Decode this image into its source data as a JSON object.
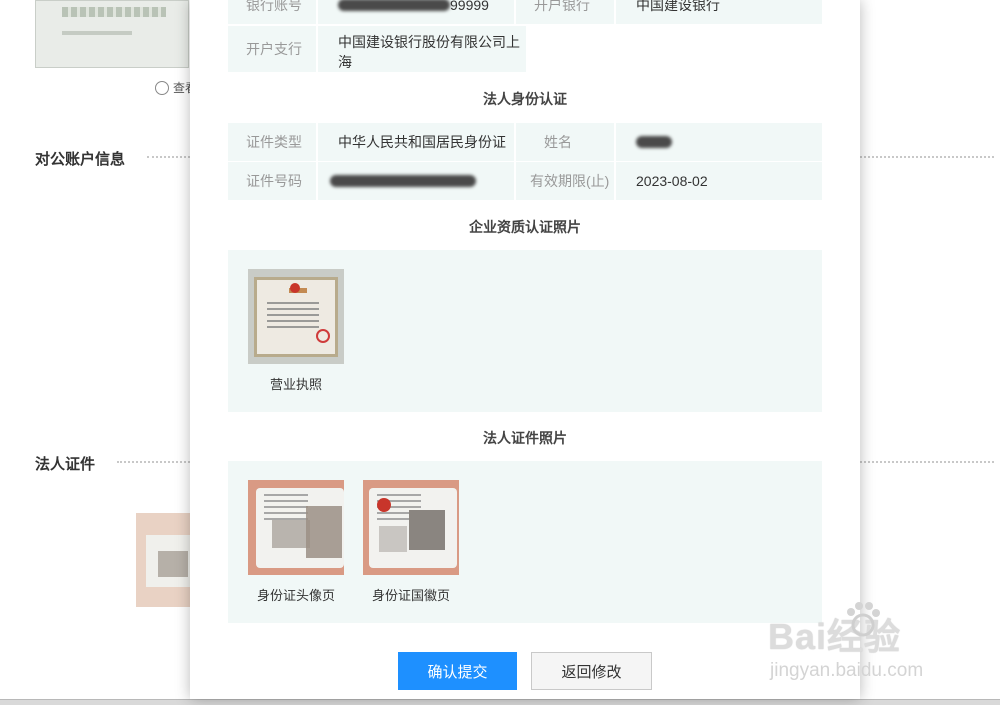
{
  "background": {
    "view_link": "查看",
    "headings": {
      "account_info": "对公账户信息",
      "legal_cert": "法人证件"
    }
  },
  "account_rows": [
    {
      "label1": "银行账号",
      "value1_visible": "99999",
      "label2": "开户银行",
      "value2": "中国建设银行"
    },
    {
      "label1": "开户支行",
      "value1": "中国建设银行股份有限公司上海"
    }
  ],
  "identity": {
    "title": "法人身份认证",
    "rows": [
      {
        "label1": "证件类型",
        "value1": "中华人民共和国居民身份证",
        "label2": "姓名",
        "value2": ""
      },
      {
        "label1": "证件号码",
        "value1": "",
        "label2": "有效期限(止)",
        "value2": "2023-08-02"
      }
    ]
  },
  "company_photos": {
    "title": "企业资质认证照片",
    "items": [
      {
        "caption": "营业执照"
      }
    ]
  },
  "legal_photos": {
    "title": "法人证件照片",
    "items": [
      {
        "caption": "身份证头像页"
      },
      {
        "caption": "身份证国徽页"
      }
    ]
  },
  "actions": {
    "confirm": "确认提交",
    "back": "返回修改"
  },
  "watermark": {
    "main": "Bai经验",
    "sub": "jingyan.baidu.com"
  },
  "colors": {
    "primary": "#1e90ff",
    "panel_bg": "#f1f8f7",
    "label": "#999999"
  }
}
